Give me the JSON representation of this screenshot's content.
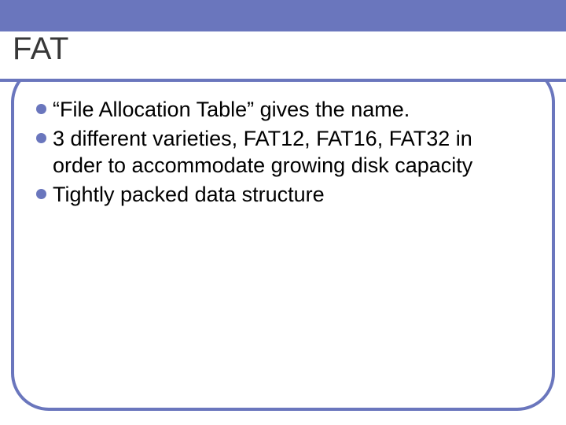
{
  "colors": {
    "accent": "#6a76bd"
  },
  "slide": {
    "title": "FAT",
    "bullets": [
      "“File Allocation Table” gives the name.",
      "3 different varieties, FAT12, FAT16, FAT32 in order to accommodate growing disk capacity",
      "Tightly packed data structure"
    ]
  }
}
